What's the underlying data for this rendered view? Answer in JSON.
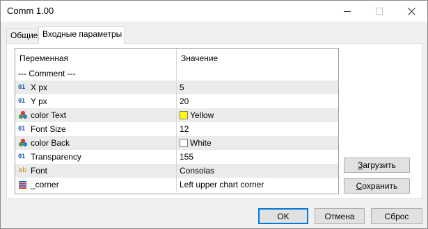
{
  "window": {
    "title": "Comm 1.00"
  },
  "tabs": [
    {
      "label": "Общие"
    },
    {
      "label": "Входные параметры"
    }
  ],
  "grid": {
    "headers": {
      "name": "Переменная",
      "value": "Значение"
    },
    "rows": [
      {
        "name": "--- Comment ---",
        "value": "",
        "icon": "none",
        "icon_text": ""
      },
      {
        "name": "X px",
        "value": "5",
        "icon": "int-icon",
        "icon_text": "01"
      },
      {
        "name": "Y px",
        "value": "20",
        "icon": "int-icon",
        "icon_text": "01"
      },
      {
        "name": "color Text",
        "value": "Yellow",
        "icon": "color-icon",
        "icon_text": "",
        "swatch": "#ffff00"
      },
      {
        "name": "Font Size",
        "value": "12",
        "icon": "int-icon",
        "icon_text": "01"
      },
      {
        "name": "color Back",
        "value": "White",
        "icon": "color-icon",
        "icon_text": "",
        "swatch": "#ffffff"
      },
      {
        "name": "Transparency",
        "value": "155",
        "icon": "int-icon",
        "icon_text": "01"
      },
      {
        "name": "Font",
        "value": "Consolas",
        "icon": "string-icon",
        "icon_text": "ab"
      },
      {
        "name": "_corner",
        "value": "Left upper chart corner",
        "icon": "enum-icon",
        "icon_text": ""
      }
    ]
  },
  "buttons": {
    "load_first": "З",
    "load_rest": "агрузить",
    "save_first": "С",
    "save_rest": "охранить",
    "ok": "OK",
    "cancel": "Отмена",
    "reset": "Сброс"
  },
  "colors": {
    "selected_tab_bg": "#ffffff",
    "row_alt_bg": "#ebebeb",
    "ok_border": "#0078d7",
    "int_icon": "#1e5fb4",
    "string_icon": "#c98a12"
  }
}
